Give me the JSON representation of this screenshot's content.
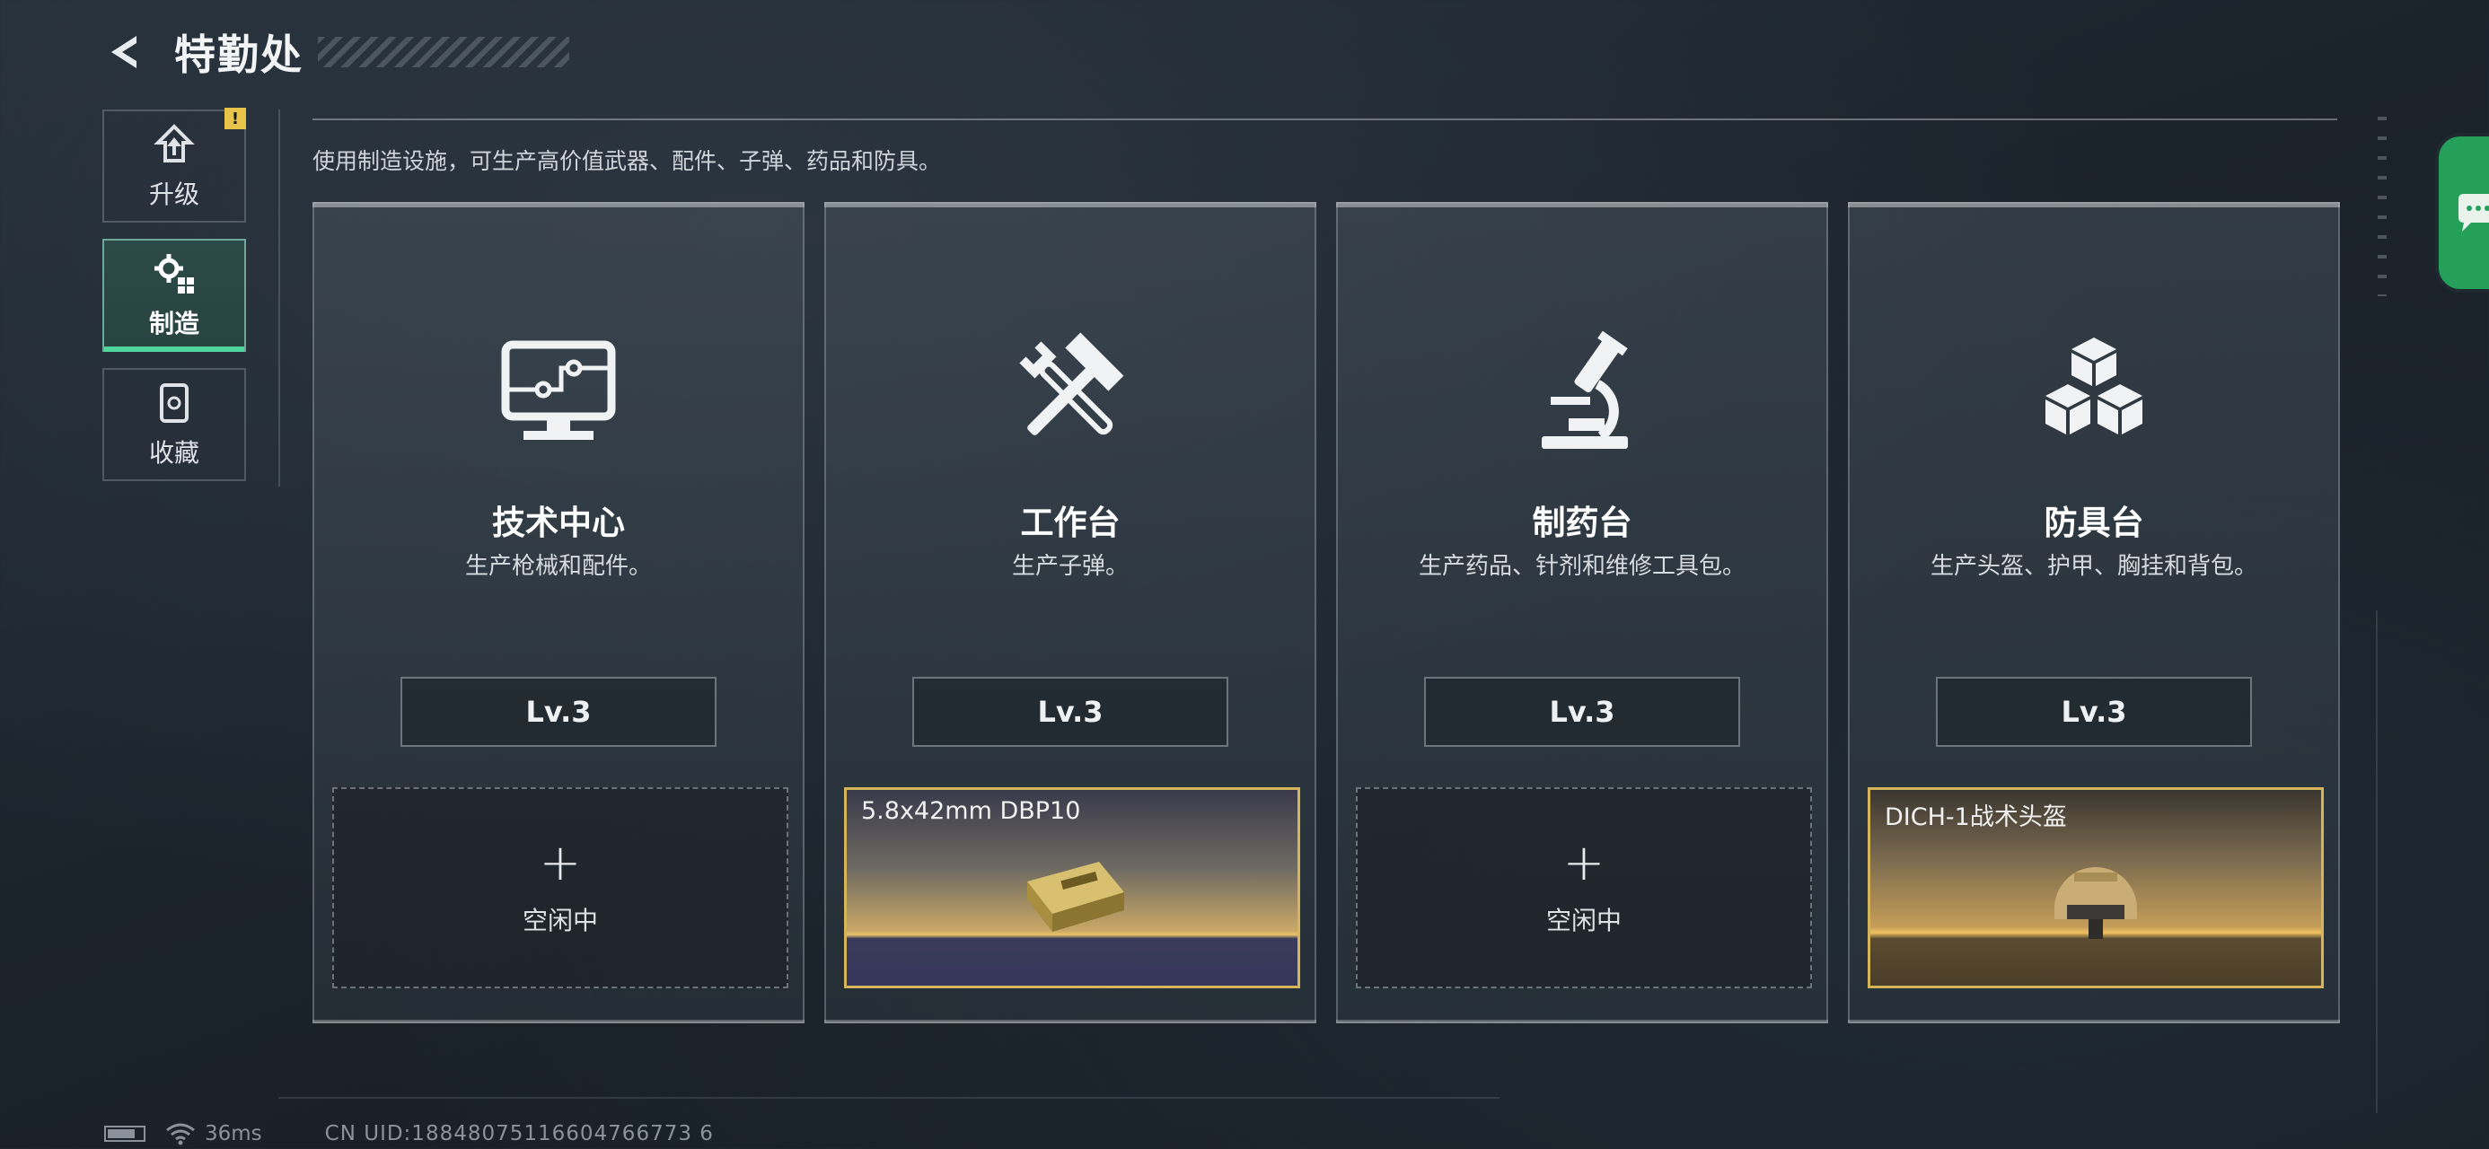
{
  "header": {
    "title": "特勤处",
    "back_icon": "back-arrow-icon"
  },
  "sidenav": {
    "items": [
      {
        "label": "升级",
        "icon": "upgrade-icon",
        "active": false,
        "alert": "!"
      },
      {
        "label": "制造",
        "icon": "gear-craft-icon",
        "active": true
      },
      {
        "label": "收藏",
        "icon": "collection-icon",
        "active": false
      }
    ]
  },
  "description": "使用制造设施，可生产高价值武器、配件、子弹、药品和防具。",
  "stations": [
    {
      "name": "技术中心",
      "desc": "生产枪械和配件。",
      "level": "Lv.3",
      "icon": "computer-icon",
      "slot": {
        "state": "empty",
        "status": "空闲中"
      }
    },
    {
      "name": "工作台",
      "desc": "生产子弹。",
      "level": "Lv.3",
      "icon": "hammer-wrench-icon",
      "slot": {
        "state": "item",
        "item_name": "5.8x42mm DBP10"
      }
    },
    {
      "name": "制药台",
      "desc": "生产药品、针剂和维修工具包。",
      "level": "Lv.3",
      "icon": "microscope-icon",
      "slot": {
        "state": "empty",
        "status": "空闲中"
      }
    },
    {
      "name": "防具台",
      "desc": "生产头盔、护甲、胸挂和背包。",
      "level": "Lv.3",
      "icon": "cubes-icon",
      "slot": {
        "state": "item",
        "item_name": "DICH-1战术头盔"
      }
    }
  ],
  "status_bar": {
    "ping": "36ms",
    "uid": "CN UID:18848075116604766773 6"
  },
  "colors": {
    "accent_green": "#4fd69c",
    "item_gold": "#d6b45a",
    "chat_green": "#24a05a",
    "alert_yellow": "#e8c34a"
  }
}
